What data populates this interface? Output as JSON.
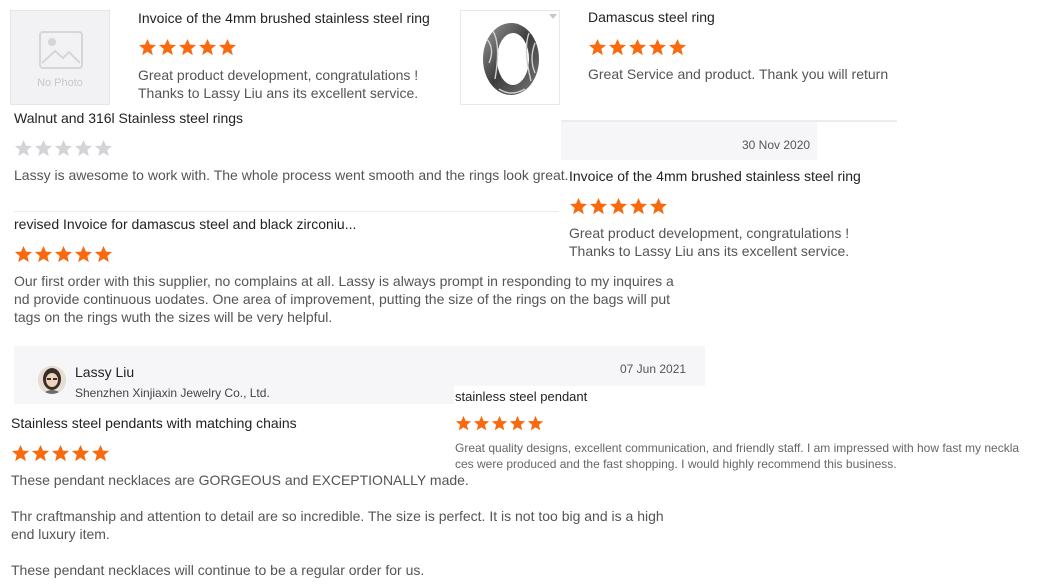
{
  "no_photo": {
    "label": "No Photo"
  },
  "review1": {
    "title": "Invoice of the 4mm brushed stainless steel ring",
    "rating": 5,
    "text_line1": "Great product development, congratulations !",
    "text_line2": "Thanks to Lassy Liu ans its excellent service."
  },
  "review2": {
    "title": "Damascus steel ring",
    "rating": 5,
    "text": "Great Service and product. Thank you will return"
  },
  "review3": {
    "title": "Walnut and 316l Stainless steel rings",
    "rating": 0,
    "text": "Lassy is awesome to work with. The whole process went smooth and the rings look great."
  },
  "reply1": {
    "date": "30 Nov 2020"
  },
  "review4": {
    "title": "Invoice of the 4mm brushed stainless steel ring",
    "rating": 5,
    "text_line1": "Great product development, congratulations !",
    "text_line2": "Thanks to Lassy Liu ans its excellent service."
  },
  "review5": {
    "title": "revised Invoice for damascus steel and black zirconiu...",
    "rating": 5,
    "text_line1": "Our first order with this supplier, no complains at all. Lassy is always prompt in responding to my inquires a",
    "text_line2": "nd provide continuous uodates. One area of improvement, putting the size of the rings on the bags will put",
    "text_line3": "tags on the rings wuth the sizes will be very helpful."
  },
  "supplier": {
    "name": "Lassy Liu",
    "company": "Shenzhen Xinjiaxin Jewelry Co., Ltd.",
    "date": "07 Jun 2021"
  },
  "review6": {
    "title": "stainless steel pendant",
    "rating": 5,
    "text_line1": "Great quality designs, excellent communication, and friendly staff. I am impressed with how fast my neckla",
    "text_line2": "ces were produced and the fast shopping. I would highly recommend this business."
  },
  "review7": {
    "title": "Stainless steel pendants with matching chains",
    "rating": 5,
    "para1": "These pendant necklaces are GORGEOUS and EXCEPTIONALLY made.",
    "para2_line1": "Thr craftmanship and attention to detail are so incredible. The size is perfect. It is not too big and is a high",
    "para2_line2": "end luxury item.",
    "para3": "These pendant necklaces will continue to be a regular order for us."
  },
  "colors": {
    "star": "#f96a0e",
    "star_empty": "#d3d3d8",
    "bar": "#f6f6f8"
  }
}
